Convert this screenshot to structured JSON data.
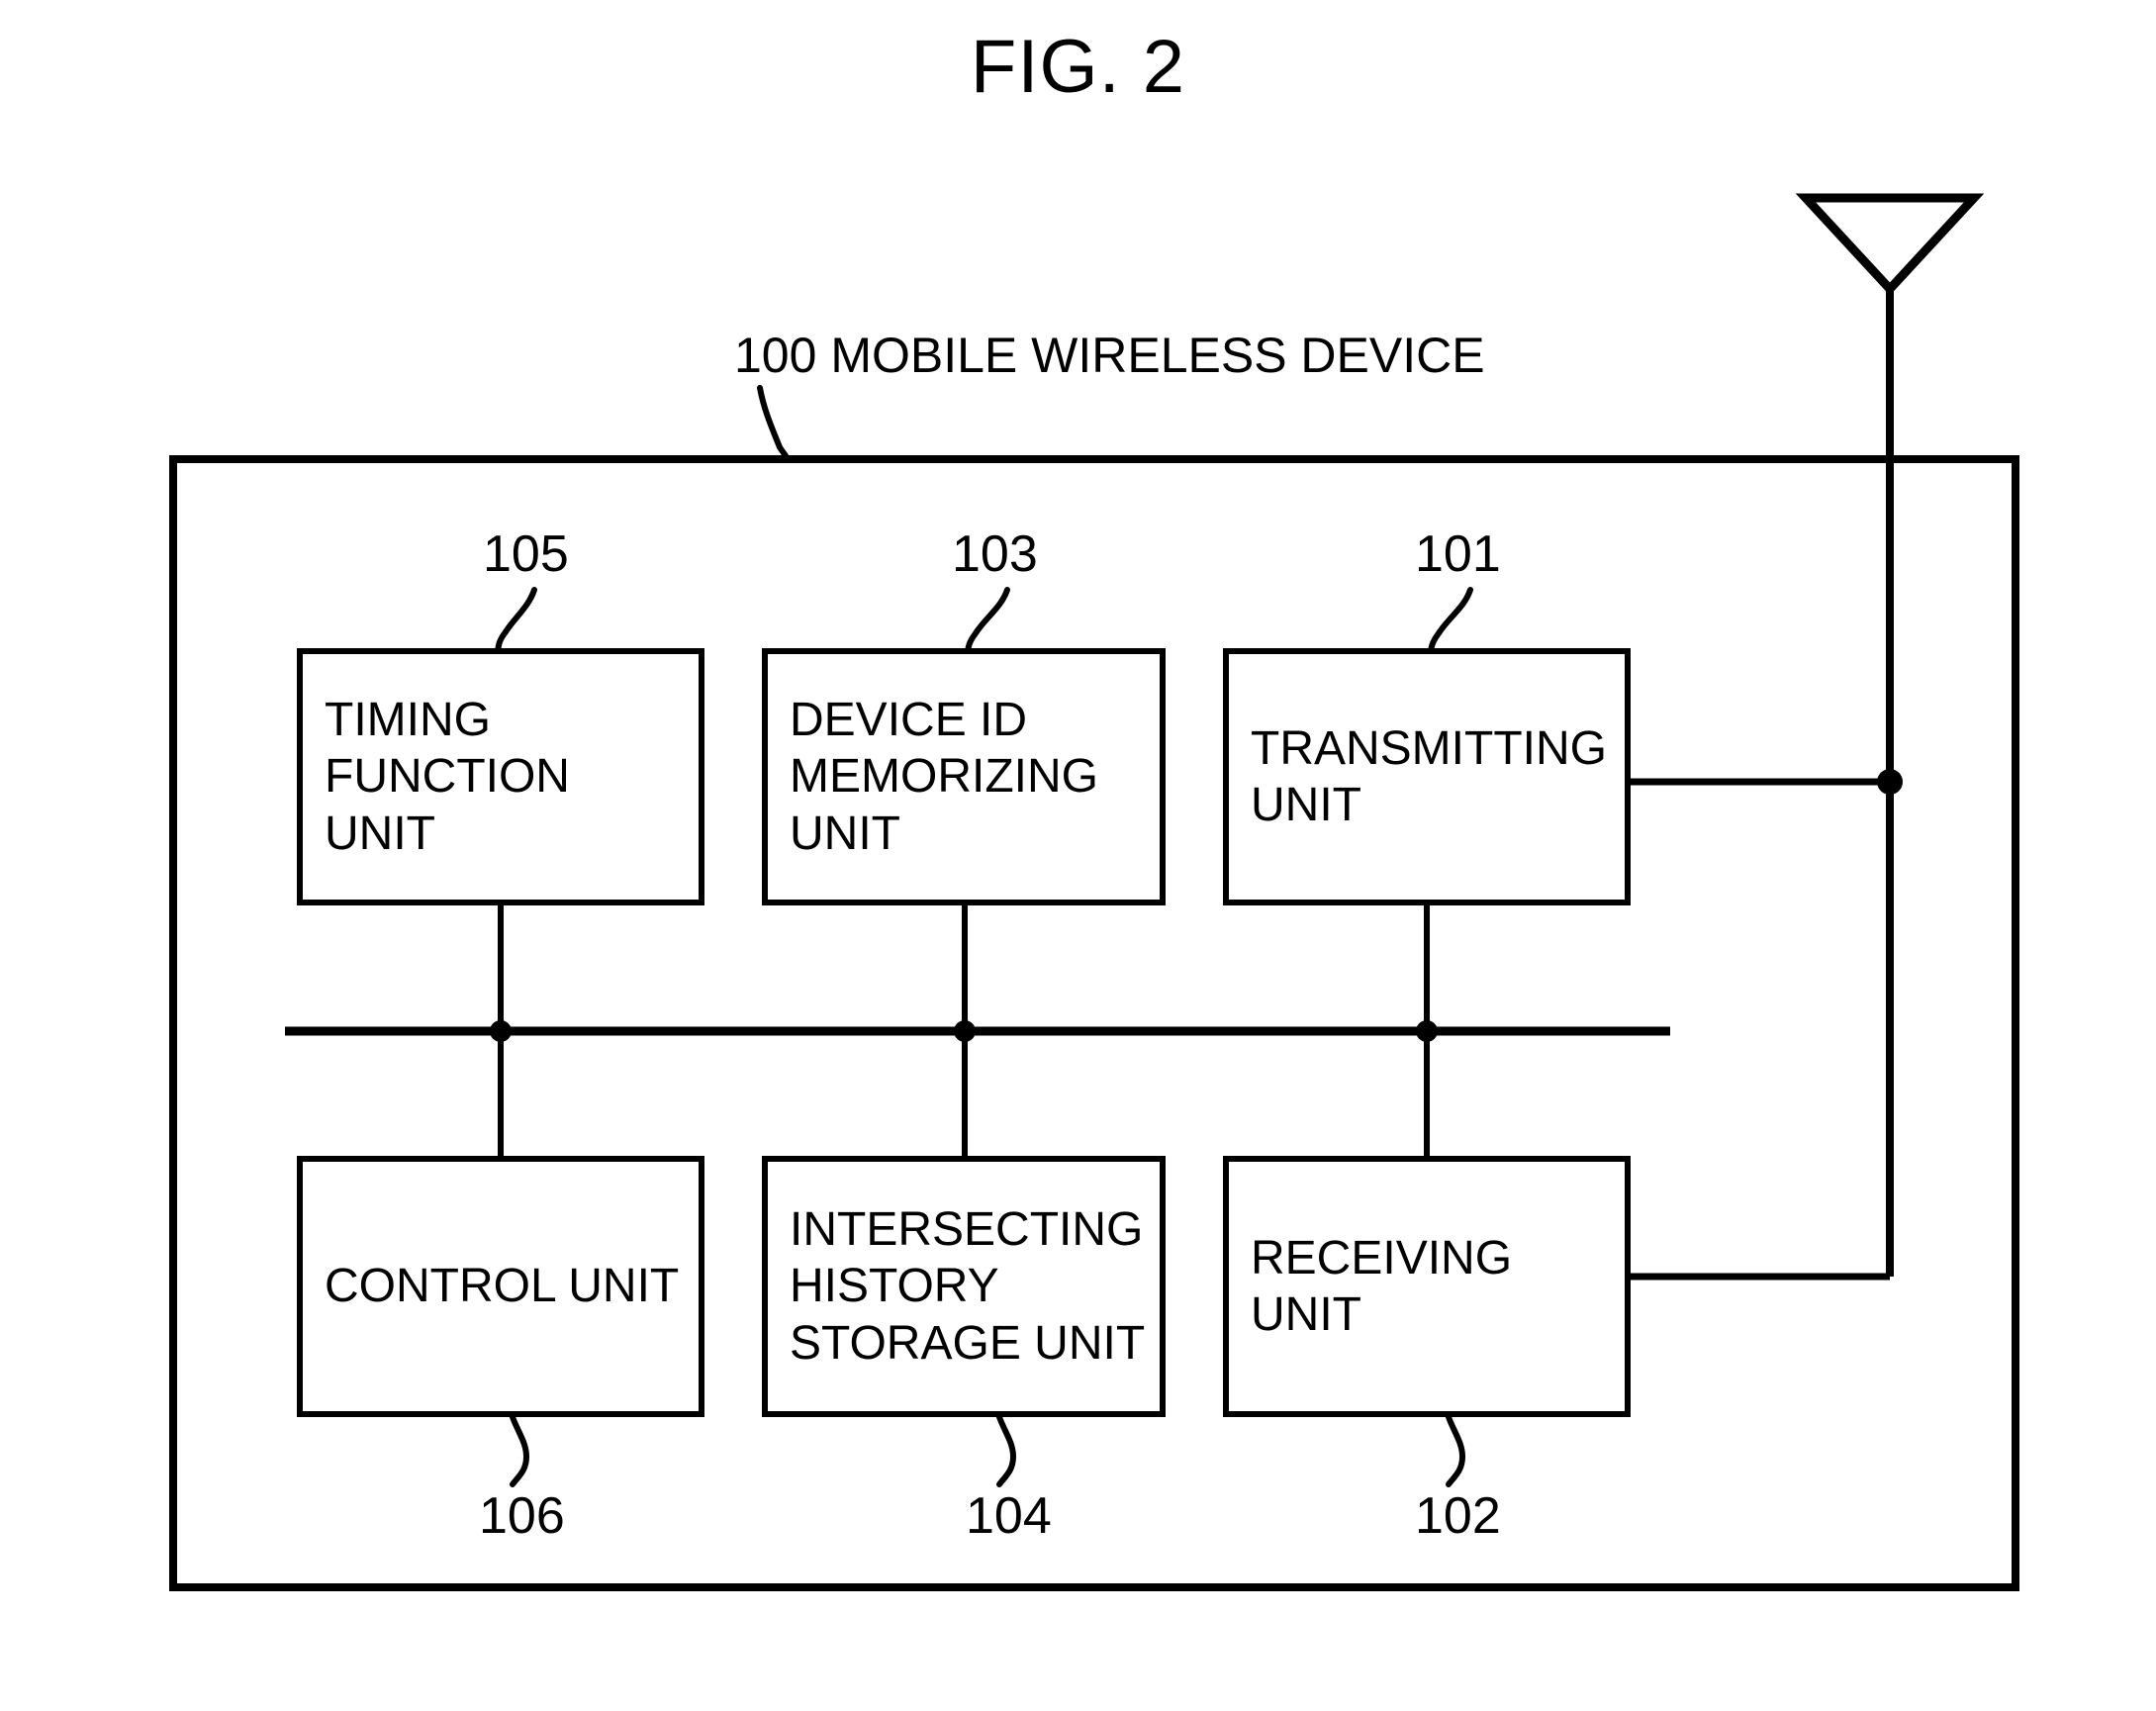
{
  "figure": {
    "title": "FIG. 2",
    "device_label": "100 MOBILE WIRELESS DEVICE",
    "device_ref": "100",
    "antenna_icon": "antenna-triangle-icon"
  },
  "blocks": [
    {
      "ref": "105",
      "label": "TIMING\nFUNCTION UNIT",
      "ref_position": "above",
      "name": "timing-function-unit"
    },
    {
      "ref": "103",
      "label": "DEVICE ID\nMEMORIZING\nUNIT",
      "ref_position": "above",
      "name": "device-id-memorizing-unit"
    },
    {
      "ref": "101",
      "label": "TRANSMITTING\nUNIT",
      "ref_position": "above",
      "name": "transmitting-unit"
    },
    {
      "ref": "106",
      "label": "CONTROL UNIT",
      "ref_position": "below",
      "name": "control-unit"
    },
    {
      "ref": "104",
      "label": "INTERSECTING\nHISTORY\nSTORAGE UNIT",
      "ref_position": "below",
      "name": "intersecting-history-storage-unit"
    },
    {
      "ref": "102",
      "label": "RECEIVING UNIT",
      "ref_position": "below",
      "name": "receiving-unit"
    }
  ],
  "colors": {
    "line": "#000000",
    "background": "#ffffff"
  }
}
